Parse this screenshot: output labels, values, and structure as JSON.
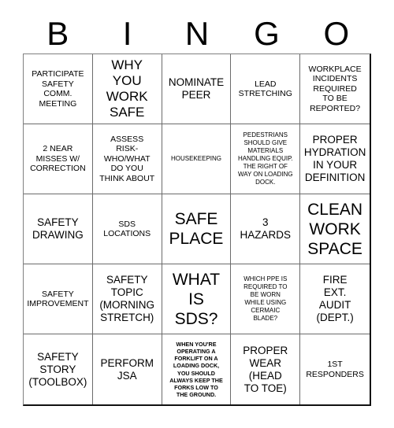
{
  "card": {
    "header_letters": [
      "B",
      "I",
      "N",
      "G",
      "O"
    ],
    "rows": [
      [
        {
          "text": "PARTICIPATE\nSAFETY\nCOMM.\nMEETING",
          "size": "sm"
        },
        {
          "text": "WHY\nYOU\nWORK\nSAFE",
          "size": "lg"
        },
        {
          "text": "NOMINATE\nPEER",
          "size": "md"
        },
        {
          "text": "LEAD\nSTRETCHING",
          "size": "sm"
        },
        {
          "text": "WORKPLACE\nINCIDENTS\nREQUIRED\nTO BE\nREPORTED?",
          "size": "sm"
        }
      ],
      [
        {
          "text": "2 NEAR\nMISSES W/\nCORRECTION",
          "size": "sm"
        },
        {
          "text": "ASSESS\nRISK-\nWHO/WHAT\nDO YOU\nTHINK ABOUT",
          "size": "sm"
        },
        {
          "text": "HOUSEKEEPING",
          "size": "xs"
        },
        {
          "text": "PEDESTRIANS\nSHOULD GIVE\nMATERIALS\nHANDLING EQUIP.\nTHE RIGHT OF\nWAY ON LOADING\nDOCK.",
          "size": "xs"
        },
        {
          "text": "PROPER\nHYDRATION\nIN YOUR\nDEFINITION",
          "size": "md"
        }
      ],
      [
        {
          "text": "SAFETY\nDRAWING",
          "size": "md"
        },
        {
          "text": "SDS\nLOCATIONS",
          "size": "sm"
        },
        {
          "text": "SAFE\nPLACE",
          "size": "xl"
        },
        {
          "text": "3\nHAZARDS",
          "size": "md"
        },
        {
          "text": "CLEAN\nWORK\nSPACE",
          "size": "xl"
        }
      ],
      [
        {
          "text": "SAFETY\nIMPROVEMENT",
          "size": "sm"
        },
        {
          "text": "SAFETY\nTOPIC\n(MORNING\nSTRETCH)",
          "size": "md"
        },
        {
          "text": "WHAT\nIS\nSDS?",
          "size": "xl"
        },
        {
          "text": "WHICH PPE IS\nREQUIRED TO\nBE WORN\nWHILE USING\nCERMAIC\nBLADE?",
          "size": "xs"
        },
        {
          "text": "FIRE\nEXT.\nAUDIT\n(DEPT.)",
          "size": "md"
        }
      ],
      [
        {
          "text": "SAFETY\nSTORY\n(TOOLBOX)",
          "size": "md"
        },
        {
          "text": "PERFORM\nJSA",
          "size": "md"
        },
        {
          "text": "WHEN YOU'RE\nOPERATING A\nFORKLIFT ON A\nLOADING DOCK,\nYOU SHOULD\nALWAYS KEEP THE\nFORKS LOW TO\nTHE GROUND.",
          "size": "xxs"
        },
        {
          "text": "PROPER\nWEAR\n(HEAD\nTO TOE)",
          "size": "md"
        },
        {
          "text": "1ST\nRESPONDERS",
          "size": "sm"
        }
      ]
    ]
  }
}
